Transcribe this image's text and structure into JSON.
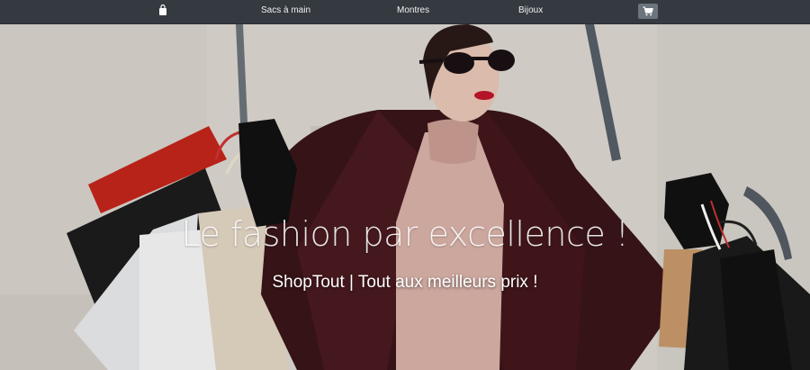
{
  "navbar": {
    "brand_icon": "shopping-bag-icon",
    "links": [
      {
        "label": "Sacs à main"
      },
      {
        "label": "Montres"
      },
      {
        "label": "Bijoux"
      }
    ],
    "cart_icon": "cart-icon",
    "background_color": "#343a40"
  },
  "hero": {
    "title": "Le fashion par excellence !",
    "subtitle": "ShopTout | Tout aux meilleurs prix !"
  }
}
